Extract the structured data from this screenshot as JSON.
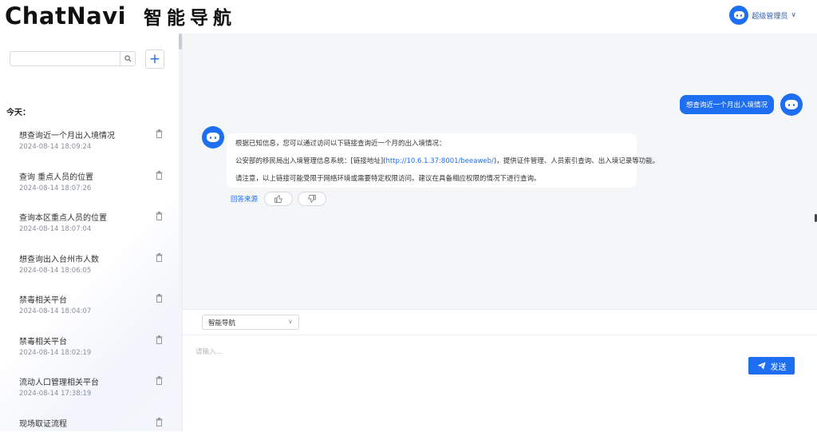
{
  "app": {
    "logo_en": "ChatNavi",
    "logo_cn": "智能导航"
  },
  "user": {
    "name": "超级管理员",
    "chevron": "∨"
  },
  "sidebar": {
    "search": {
      "value": "",
      "placeholder": ""
    },
    "add_label": "+",
    "section_label": "今天：",
    "items": [
      {
        "title": "想查询近一个月出入境情况",
        "time": "2024-08-14 18:09:24"
      },
      {
        "title": "查询 重点人员的位置",
        "time": "2024-08-14 18:07:26"
      },
      {
        "title": "查询本区重点人员的位置",
        "time": "2024-08-14 18:07:04"
      },
      {
        "title": "想查询出入台州市人数",
        "time": "2024-08-14 18:06:05"
      },
      {
        "title": "禁毒相关平台",
        "time": "2024-08-14 18:04:07"
      },
      {
        "title": "禁毒相关平台",
        "time": "2024-08-14 18:02:19"
      },
      {
        "title": "流动人口管理相关平台",
        "time": "2024-08-14 17:38:19"
      },
      {
        "title": "现场取证流程",
        "time": ""
      }
    ]
  },
  "chat": {
    "user_message": "想查询近一个月出入境情况",
    "bot_message": {
      "line1": "根据已知信息，您可以通过访问以下链接查询近一个月的出入境情况：",
      "line2_prefix": "公安部的移民局出入境管理信息系统：[链接地址](",
      "line2_link": "http://10.6.1.37:8001/beeaweb/",
      "line2_suffix": ")，提供证件管理、人员索引查询、出入境记录等功能。",
      "line3": "请注意，以上链接可能受限于网络环境或需要特定权限访问。建议在具备相应权限的情况下进行查询。"
    },
    "source_label": "回答来源"
  },
  "composer": {
    "mode_value": "智能导航",
    "mode_arrow": "∨",
    "placeholder": "请输入...",
    "send_label": "发送"
  },
  "colors": {
    "accent": "#1e6ef2",
    "background": "#f5f6f8"
  },
  "icons": {
    "search": "search-icon",
    "add": "plus-icon",
    "delete": "trash-icon",
    "like": "thumbs-up-icon",
    "dislike": "thumbs-down-icon",
    "send": "paper-plane-icon",
    "avatar": "robot-avatar-icon"
  }
}
